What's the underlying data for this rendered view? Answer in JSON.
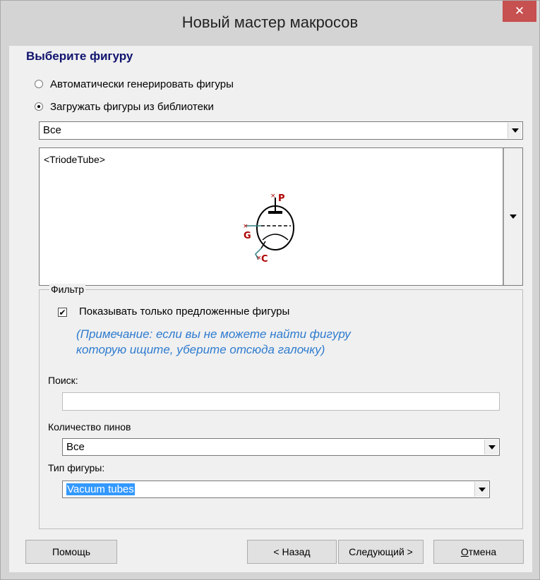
{
  "window": {
    "title": "Новый мастер макросов",
    "close_icon": "close-icon"
  },
  "heading": "Выберите фигуру",
  "radios": [
    {
      "label": "Автоматически генерировать фигуры",
      "selected": false
    },
    {
      "label": "Загружать фигуры из библиотеки",
      "selected": true
    }
  ],
  "library_select": {
    "value": "Все"
  },
  "preview": {
    "name": "<TriodeTube>",
    "pins": {
      "plate": "P",
      "grid": "G",
      "cathode": "C"
    }
  },
  "filter": {
    "legend": "Фильтр",
    "checkbox": {
      "label": "Показывать только предложенные фигуры",
      "checked": true
    },
    "note_line1": "(Примечание: если вы не можете найти фигуру",
    "note_line2": "которую ищите, уберите отсюда галочку)",
    "search_label": "Поиск:",
    "search_value": "",
    "pins_label": "Количество пинов",
    "pins_value": "Все",
    "type_label": "Тип фигуры:",
    "type_value": "Vacuum tubes"
  },
  "buttons": {
    "help": "Помощь",
    "back": "< Назад",
    "next": "Следующий >",
    "cancel_first": "О",
    "cancel_rest": "тмена"
  },
  "colors": {
    "heading": "#10136e",
    "note": "#2e7bcf",
    "close": "#c75050",
    "pin_label": "#b00000",
    "selection": "#3399ff"
  }
}
